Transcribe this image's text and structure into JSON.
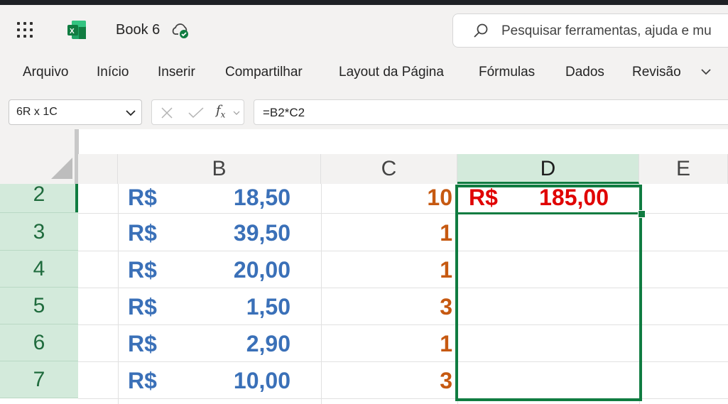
{
  "titlebar": {
    "book_title": "Book 6",
    "search_placeholder": "Pesquisar ferramentas, ajuda e mu"
  },
  "ribbon": {
    "tabs": [
      "Arquivo",
      "Início",
      "Inserir",
      "Compartilhar",
      "Layout da Página",
      "Fórmulas",
      "Dados",
      "Revisão"
    ]
  },
  "formula_bar": {
    "name_box": "6R x 1C",
    "fx_label": "fx",
    "formula": "=B2*C2"
  },
  "grid": {
    "columns": [
      "B",
      "C",
      "D",
      "E"
    ],
    "rows": [
      {
        "num": "2",
        "b_cur": "R$",
        "b_val": "18,50",
        "c_val": "10",
        "d_cur": "R$",
        "d_val": "185,00"
      },
      {
        "num": "3",
        "b_cur": "R$",
        "b_val": "39,50",
        "c_val": "1"
      },
      {
        "num": "4",
        "b_cur": "R$",
        "b_val": "20,00",
        "c_val": "1"
      },
      {
        "num": "5",
        "b_cur": "R$",
        "b_val": "1,50",
        "c_val": "3"
      },
      {
        "num": "6",
        "b_cur": "R$",
        "b_val": "2,90",
        "c_val": "1"
      },
      {
        "num": "7",
        "b_cur": "R$",
        "b_val": "10,00",
        "c_val": "3"
      }
    ]
  },
  "colors": {
    "accent": "#107c41",
    "currency_blue": "#3a70b8",
    "quantity_orange": "#c65911",
    "result_red": "#e00000"
  }
}
